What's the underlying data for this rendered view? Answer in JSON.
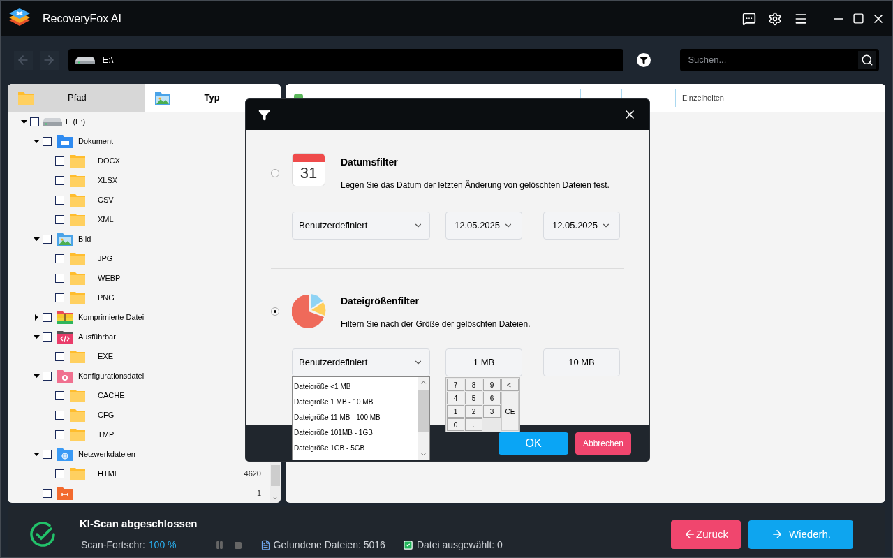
{
  "window": {
    "title": "RecoveryFox AI"
  },
  "toolbar": {
    "path": "E:\\",
    "search": {
      "placeholder": "Suchen..."
    }
  },
  "tabs": [
    {
      "label": "Pfad",
      "selected": false,
      "kind": "folder"
    },
    {
      "label": "Typ",
      "selected": true,
      "kind": "image"
    }
  ],
  "tree": [
    {
      "label": "E (E:)",
      "kind": "drive",
      "expanded": true,
      "checked": false,
      "children": [
        {
          "label": "Dokument",
          "kind": "document",
          "expanded": true,
          "checked": false,
          "children": [
            {
              "label": "DOCX",
              "kind": "folder",
              "checked": false
            },
            {
              "label": "XLSX",
              "kind": "folder",
              "checked": false
            },
            {
              "label": "CSV",
              "kind": "folder",
              "checked": false
            },
            {
              "label": "XML",
              "kind": "folder",
              "checked": false
            }
          ]
        },
        {
          "label": "Bild",
          "kind": "image",
          "expanded": true,
          "checked": false,
          "children": [
            {
              "label": "JPG",
              "kind": "folder",
              "checked": false
            },
            {
              "label": "WEBP",
              "kind": "folder",
              "checked": false
            },
            {
              "label": "PNG",
              "kind": "folder",
              "checked": false
            }
          ]
        },
        {
          "label": "Komprimierte Datei",
          "kind": "archive",
          "expanded": false,
          "checked": false
        },
        {
          "label": "Ausführbar",
          "kind": "executable",
          "expanded": true,
          "checked": false,
          "children": [
            {
              "label": "EXE",
              "kind": "folder",
              "checked": false
            }
          ]
        },
        {
          "label": "Konfigurationsdatei",
          "kind": "config",
          "expanded": true,
          "checked": false,
          "children": [
            {
              "label": "CACHE",
              "kind": "folder",
              "checked": false
            },
            {
              "label": "CFG",
              "kind": "folder",
              "checked": false
            },
            {
              "label": "TMP",
              "kind": "folder",
              "checked": false
            }
          ]
        },
        {
          "label": "Netzwerkdateien",
          "kind": "network",
          "expanded": true,
          "checked": false,
          "children": [
            {
              "label": "HTML",
              "kind": "folder",
              "checked": false,
              "count": "4620"
            }
          ]
        },
        {
          "kind": "other",
          "checked": false,
          "count": "1"
        }
      ]
    }
  ],
  "table": {
    "select_all": {
      "checked": true
    },
    "columns": [
      "Einzelheiten"
    ]
  },
  "dialog": {
    "date_filter": {
      "selected": false,
      "title": "Datumsfilter",
      "description": "Legen Sie das Datum der letzten Änderung von gelöschten Dateien fest.",
      "calendar_day": "31",
      "preset": "Benutzerdefiniert",
      "from": "12.05.2025",
      "to": "12.05.2025"
    },
    "size_filter": {
      "selected": true,
      "title": "Dateigrößenfilter",
      "description": "Filtern Sie nach der Größe der gelöschten Dateien.",
      "preset": "Benutzerdefiniert",
      "from": "1 MB",
      "to": "10 MB",
      "options": [
        "Dateigröße <1 MB",
        "Dateigröße 1 MB - 10 MB",
        "Dateigröße 11 MB - 100 MB",
        "Dateigröße 101MB - 1GB",
        "Dateigröße 1GB - 5GB"
      ],
      "keypad": [
        [
          "7",
          "8",
          "9",
          "<-"
        ],
        [
          "4",
          "5",
          "6"
        ],
        [
          "1",
          "2",
          "3"
        ],
        [
          "0",
          "."
        ]
      ],
      "clear_key": "CE"
    },
    "buttons": {
      "ok": "OK",
      "cancel": "Abbrechen"
    }
  },
  "status": {
    "title": "KI-Scan abgeschlossen",
    "progress_label": "Scan-Fortschr:",
    "progress_value": "100 %",
    "found": "Gefundene Dateien: 5016",
    "selected": "Datei ausgewählt: 0"
  },
  "footer_buttons": {
    "back": "Zurück",
    "recover": "Wiederh."
  }
}
